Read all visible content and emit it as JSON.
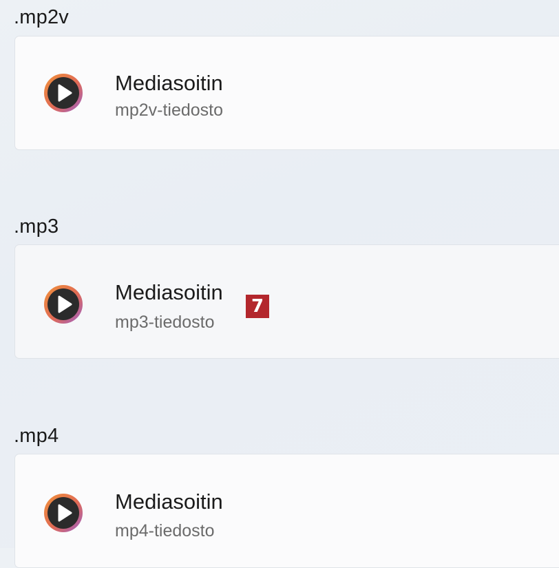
{
  "associations": [
    {
      "extension": ".mp2v",
      "app_name": "Mediasoitin",
      "file_type": "mp2v-tiedosto",
      "icon": "media-player-icon"
    },
    {
      "extension": ".mp3",
      "app_name": "Mediasoitin",
      "file_type": "mp3-tiedosto",
      "icon": "media-player-icon"
    },
    {
      "extension": ".mp4",
      "app_name": "Mediasoitin",
      "file_type": "mp4-tiedosto",
      "icon": "media-player-icon"
    }
  ],
  "marker": {
    "label": "7",
    "color": "#b3272d"
  },
  "colors": {
    "icon_ring_start": "#e8833a",
    "icon_ring_end": "#9c5fc9",
    "icon_fill": "#2b2b2b"
  }
}
